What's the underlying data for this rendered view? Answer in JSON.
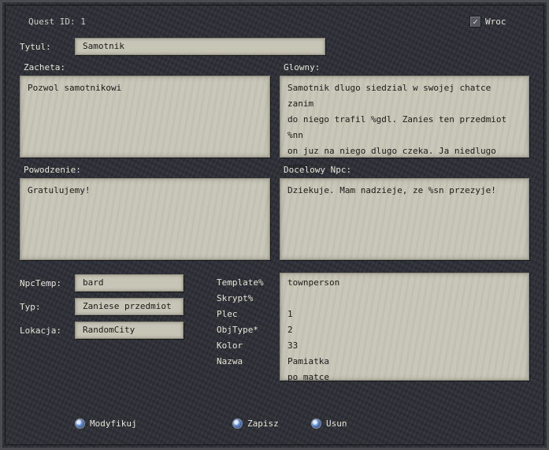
{
  "header": {
    "quest_id_label": "Quest ID: 1",
    "back_label": "Wroc"
  },
  "title_field": {
    "label": "Tytul:",
    "value": "Samotnik"
  },
  "zacheta": {
    "label": "Zacheta:",
    "text": "Pozwol samotnikowi"
  },
  "glowny": {
    "label": "Glowny:",
    "text": "Samotnik dlugo siedzial w swojej chatce zanim\ndo niego trafil %gdl. Zanies ten przedmiot %nn\non juz na niego dlugo czeka. Ja niedlugo umre.\nJestem chory."
  },
  "powodzenie": {
    "label": "Powodzenie:",
    "text": "Gratulujemy!"
  },
  "docelowy_npc": {
    "label": "Docelowy Npc:",
    "text": "Dziekuje. Mam nadzieje, ze %sn przezyje!"
  },
  "left_fields": [
    {
      "label": "NpcTemp:",
      "value": "bard"
    },
    {
      "label": "Typ:",
      "value": "Zaniese przedmiot"
    },
    {
      "label": "Lokacja:",
      "value": "RandomCity"
    }
  ],
  "properties": [
    {
      "key": "Template%",
      "value": "townperson"
    },
    {
      "key": "Skrypt%",
      "value": ""
    },
    {
      "key": "Plec",
      "value": "1"
    },
    {
      "key": "ObjType*",
      "value": "2"
    },
    {
      "key": "Kolor",
      "value": "33"
    },
    {
      "key": "Nazwa",
      "value": "Pamiatka po matce"
    }
  ],
  "buttons": {
    "modify": "Modyfikuj",
    "save": "Zapisz",
    "delete": "Usun"
  },
  "colors": {
    "background": "#2e3037",
    "parchment": "#c7c5b6",
    "text_light": "#e8e4d8",
    "text_dark": "#1a1a1a"
  }
}
